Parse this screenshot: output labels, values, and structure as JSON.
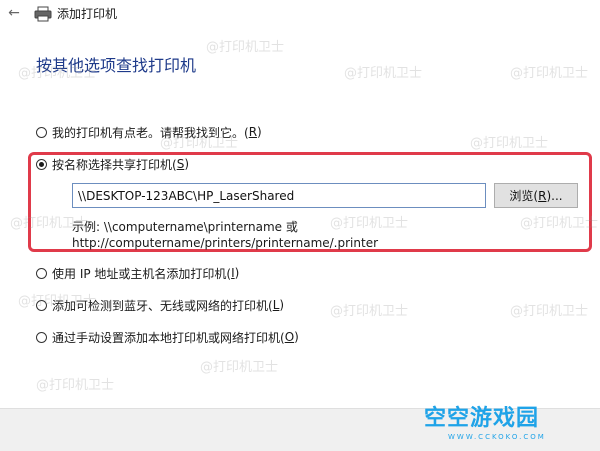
{
  "window": {
    "title": "添加打印机"
  },
  "main": {
    "heading": "按其他选项查找打印机",
    "options": [
      {
        "text": "我的打印机有点老。请帮我找到它。(",
        "key": "R",
        "suffix": ")",
        "checked": false
      },
      {
        "text": "按名称选择共享打印机(",
        "key": "S",
        "suffix": ")",
        "checked": true
      },
      {
        "text": "使用 IP 地址或主机名添加打印机(",
        "key": "I",
        "suffix": ")",
        "checked": false
      },
      {
        "text": "添加可检测到蓝牙、无线或网络的打印机(",
        "key": "L",
        "suffix": ")",
        "checked": false
      },
      {
        "text": "通过手动设置添加本地打印机或网络打印机(",
        "key": "O",
        "suffix": ")",
        "checked": false
      }
    ],
    "share_input_value": "\\\\DESKTOP-123ABC\\HP_LaserShared",
    "browse": {
      "text": "浏览(",
      "key": "R",
      "suffix": ")..."
    },
    "example_line1": "示例: \\\\computername\\printername 或",
    "example_line2": "http://computername/printers/printername/.printer"
  },
  "watermark_text": "@打印机卫士",
  "logo": {
    "text": "空空游戏园",
    "url": "WWW.CCKOKO.COM"
  },
  "colors": {
    "heading": "#1e3a8a",
    "highlight": "#e03a4a",
    "logo": "#1fa3e8"
  }
}
